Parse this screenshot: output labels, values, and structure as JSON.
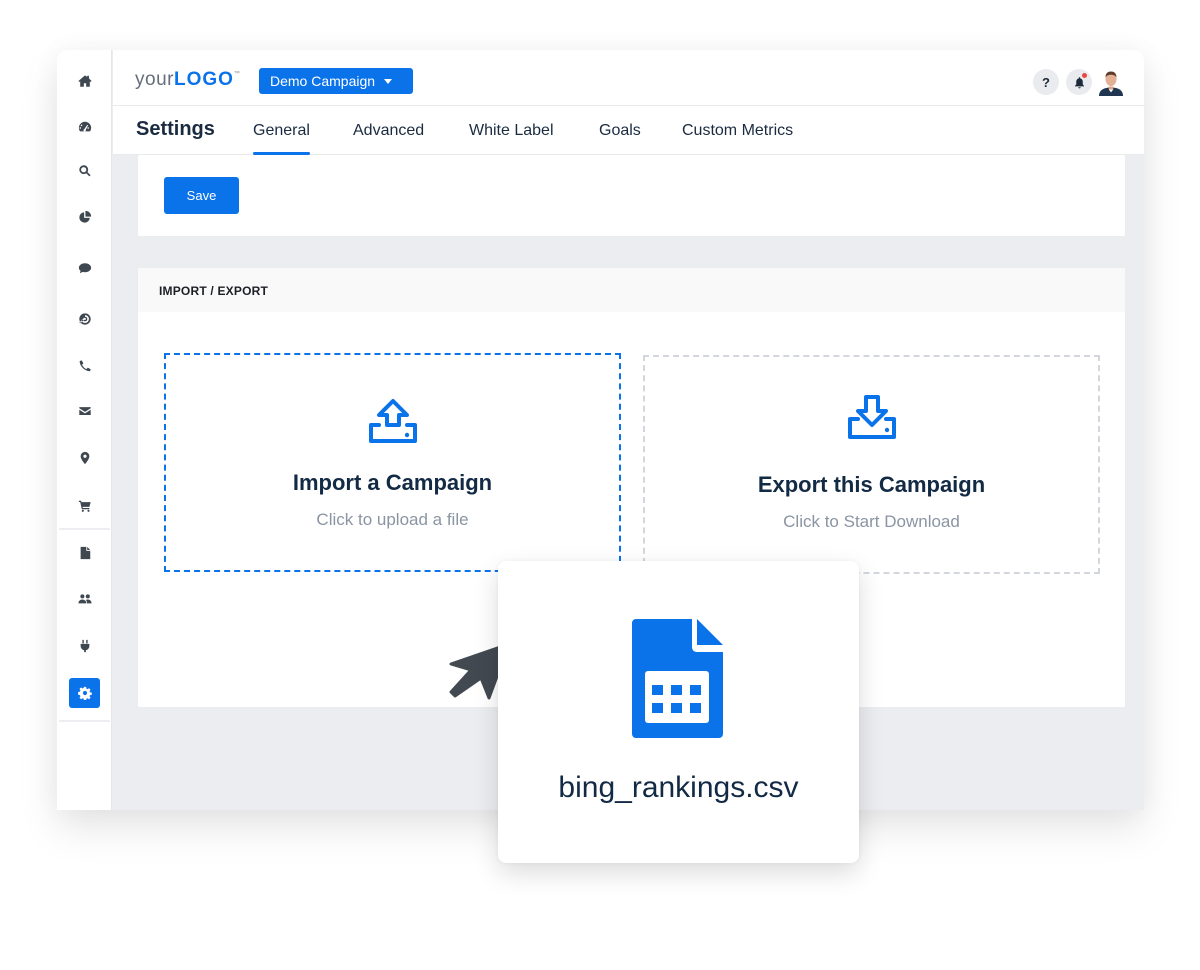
{
  "brand": {
    "logo_prefix": "your",
    "logo_bold": "LOGO",
    "logo_tm": "™",
    "accent_color": "#0b73ea"
  },
  "header": {
    "campaign_selector": "Demo Campaign",
    "help_label": "?",
    "icons": [
      "help-icon",
      "bell-icon",
      "avatar"
    ]
  },
  "sidebar": {
    "items": [
      {
        "icon": "home-icon"
      },
      {
        "icon": "dashboard-gauge-icon"
      },
      {
        "icon": "search-icon"
      },
      {
        "icon": "pie-chart-icon"
      },
      {
        "icon": "chat-bubble-icon"
      },
      {
        "icon": "target-icon"
      },
      {
        "icon": "phone-icon"
      },
      {
        "icon": "envelope-icon"
      },
      {
        "icon": "map-pin-icon"
      },
      {
        "icon": "shopping-cart-icon"
      },
      {
        "icon": "file-icon"
      },
      {
        "icon": "users-icon"
      },
      {
        "icon": "plug-icon"
      },
      {
        "icon": "gear-icon",
        "active": true
      }
    ]
  },
  "settings": {
    "title": "Settings",
    "tabs": [
      {
        "label": "General",
        "active": true
      },
      {
        "label": "Advanced"
      },
      {
        "label": "White Label"
      },
      {
        "label": "Goals"
      },
      {
        "label": "Custom Metrics"
      }
    ],
    "save_label": "Save"
  },
  "import_export": {
    "section_title": "IMPORT / EXPORT",
    "import": {
      "title": "Import a Campaign",
      "subtitle": "Click to upload a file",
      "icon": "upload-icon"
    },
    "export": {
      "title": "Export this Campaign",
      "subtitle": "Click to Start Download",
      "icon": "download-icon"
    }
  },
  "dragged_file": {
    "name": "bing_rankings.csv",
    "icon": "csv-file-icon"
  }
}
